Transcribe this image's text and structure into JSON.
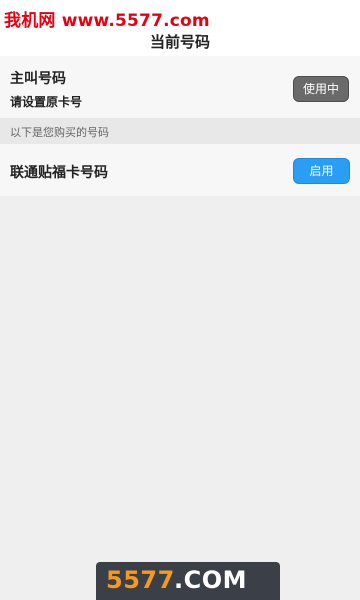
{
  "watermark": {
    "top_text": "我机网 www.5577.com",
    "bottom_number": "5577",
    "bottom_domain": ".COM"
  },
  "header": {
    "title": "当前号码"
  },
  "primary": {
    "title": "主叫号码",
    "subtitle": "请设置原卡号",
    "button_label": "使用中"
  },
  "section": {
    "header": "以下是您购买的号码"
  },
  "purchased": {
    "items": [
      {
        "label": "联通贴福卡号码",
        "button_label": "启用"
      }
    ]
  },
  "colors": {
    "watermark_red": "#e60012",
    "enable_blue": "#2a9df4",
    "inuse_gray": "#6a6a6a",
    "badge_orange": "#f59a1c"
  }
}
